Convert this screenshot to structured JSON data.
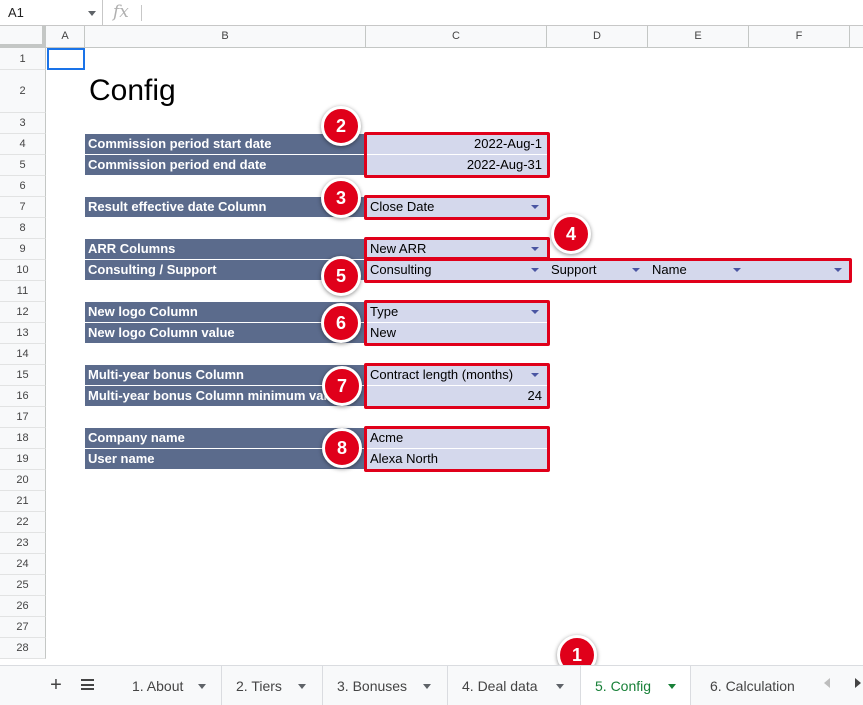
{
  "formula_bar": {
    "cell_ref": "A1",
    "fx_icon": "function-icon"
  },
  "columns": [
    "A",
    "B",
    "C",
    "D",
    "E",
    "F"
  ],
  "rows": [
    "1",
    "2",
    "3",
    "4",
    "5",
    "6",
    "7",
    "8",
    "9",
    "10",
    "11",
    "12",
    "13",
    "14",
    "15",
    "16",
    "17",
    "18",
    "19",
    "20",
    "21",
    "22",
    "23",
    "24",
    "25",
    "26",
    "27",
    "28"
  ],
  "sheet": {
    "title": "Config",
    "fields": {
      "period_start_label": "Commission period start date",
      "period_start_value": "2022-Aug-1",
      "period_end_label": "Commission period end date",
      "period_end_value": "2022-Aug-31",
      "effective_date_label": "Result effective date Column",
      "effective_date_value": "Close Date",
      "arr_label": "ARR Columns",
      "arr_value": "New ARR",
      "consulting_label": "Consulting / Support",
      "consulting_values": [
        "Consulting",
        "Support",
        "Name",
        ""
      ],
      "new_logo_label": "New logo Column",
      "new_logo_value": "Type",
      "new_logo_value_label": "New logo Column value",
      "new_logo_value_value": "New",
      "multiyear_label": "Multi-year bonus Column",
      "multiyear_value": "Contract length (months)",
      "multiyear_min_label": "Multi-year bonus Column minimum value",
      "multiyear_min_value": "24",
      "company_label": "Company name",
      "company_value": "Acme",
      "user_label": "User name",
      "user_value": "Alexa North"
    }
  },
  "annotations": [
    "1",
    "2",
    "3",
    "4",
    "5",
    "6",
    "7",
    "8"
  ],
  "tabbar": {
    "add_label": "+",
    "tabs": [
      "1. About",
      "2. Tiers",
      "3. Bonuses",
      "4. Deal data",
      "5. Config",
      "6. Calculation"
    ],
    "active_tab": "5. Config"
  },
  "colors": {
    "label_bg": "#5b6b8c",
    "value_bg": "#d4d8ec",
    "annotation": "#e0001a",
    "active_tab": "#188038"
  }
}
